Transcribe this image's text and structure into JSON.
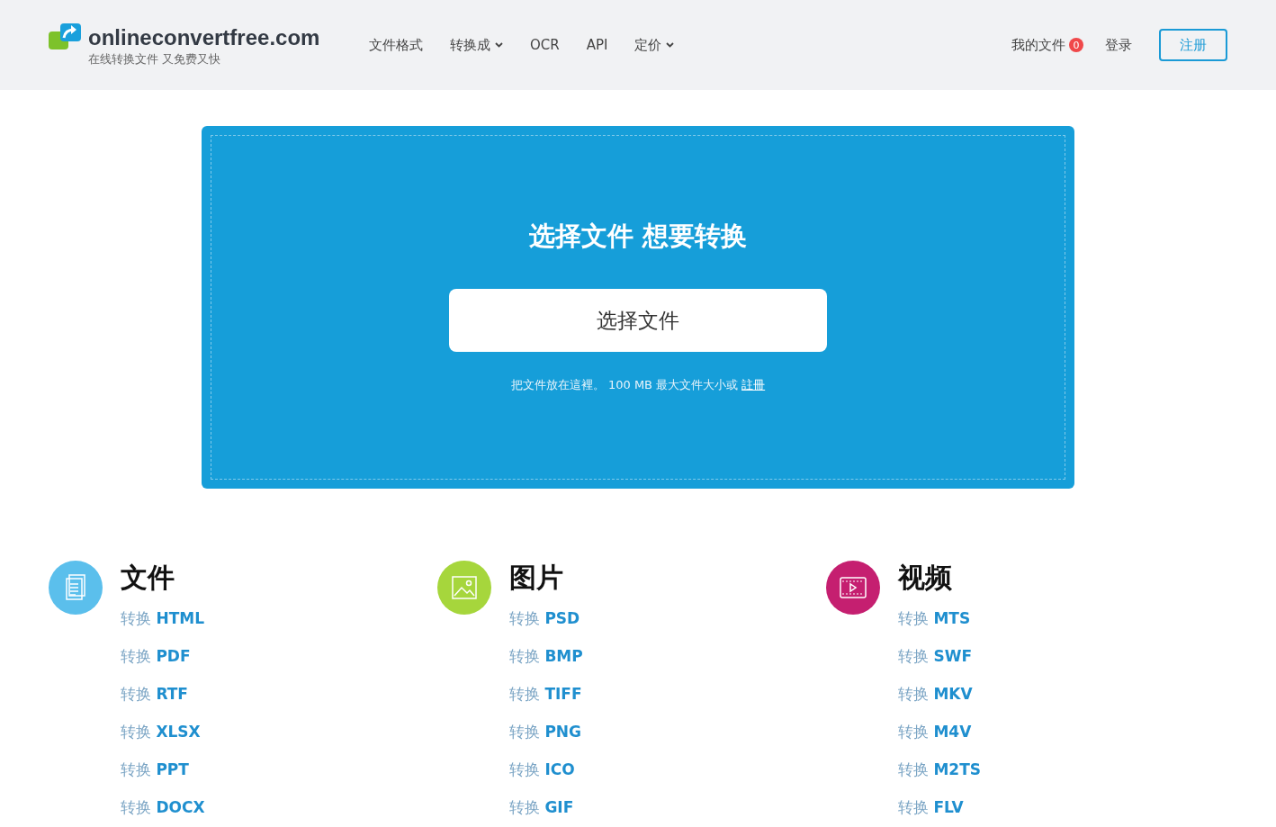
{
  "header": {
    "logo_text": "onlineconvertfree.com",
    "tagline": "在线转换文件 又免费又快",
    "nav": [
      {
        "label": "文件格式",
        "has_menu": false
      },
      {
        "label": "转换成",
        "has_menu": true
      },
      {
        "label": "OCR",
        "has_menu": false
      },
      {
        "label": "API",
        "has_menu": false
      },
      {
        "label": "定价",
        "has_menu": true
      }
    ],
    "my_files": {
      "label": "我的文件",
      "count": "0"
    },
    "login": "登录",
    "register": "注册"
  },
  "upload": {
    "title": "选择文件 想要转换",
    "button": "选择文件",
    "hint": "把文件放在這裡。 100 MB 最大文件大小或",
    "hint_link": "註冊"
  },
  "categories": [
    {
      "kind": "document",
      "title": "文件",
      "color": "#5bbfec",
      "links": [
        "转换 **HTML**",
        "转换 **PDF**",
        "转换 **RTF**",
        "转换 **XLSX**",
        "转换 **PPT**",
        "转换 **DOCX**"
      ]
    },
    {
      "kind": "image",
      "title": "图片",
      "color": "#a6d63c",
      "links": [
        "转换 **PSD**",
        "转换 **BMP**",
        "转换 **TIFF**",
        "转换 **PNG**",
        "转换 **ICO**",
        "转换 **GIF**"
      ]
    },
    {
      "kind": "video",
      "title": "视频",
      "color": "#c51f70",
      "links": [
        "转换 **MTS**",
        "转换 **SWF**",
        "转换 **MKV**",
        "转换 **M4V**",
        "转换 **M2TS**",
        "转换 **FLV**"
      ]
    }
  ]
}
